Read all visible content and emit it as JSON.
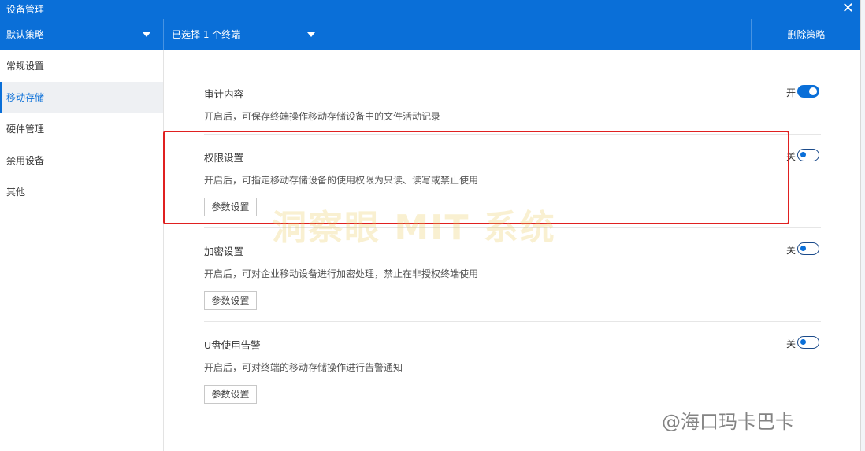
{
  "window": {
    "title": "设备管理",
    "close_glyph": "✕"
  },
  "toolbar": {
    "policy_select": "默认策略",
    "terminal_select": "已选择 1 个终端",
    "delete_label": "删除策略"
  },
  "sidebar": {
    "items": [
      {
        "label": "常规设置",
        "active": false
      },
      {
        "label": "移动存储",
        "active": true
      },
      {
        "label": "硬件管理",
        "active": false
      },
      {
        "label": "禁用设备",
        "active": false
      },
      {
        "label": "其他",
        "active": false
      }
    ]
  },
  "sections": [
    {
      "title": "审计内容",
      "desc": "开启后，可保存终端操作移动存储设备中的文件活动记录",
      "state_label": "开",
      "enabled": true
    },
    {
      "title": "权限设置",
      "desc": "开启后，可指定移动存储设备的使用权限为只读、读写或禁止使用",
      "state_label": "关",
      "enabled": false,
      "button": "参数设置"
    },
    {
      "title": "加密设置",
      "desc": "开启后，可对企业移动设备进行加密处理，禁止在非授权终端使用",
      "state_label": "关",
      "enabled": false,
      "button": "参数设置"
    },
    {
      "title": "U盘使用告警",
      "desc": "开启后，可对终端的移动存储操作进行告警通知",
      "state_label": "关",
      "enabled": false,
      "button": "参数设置"
    }
  ],
  "watermarks": {
    "center": "洞察眼 MIT 系统",
    "corner": "@海口玛卡巴卡"
  },
  "colors": {
    "accent": "#0a6fd8",
    "highlight": "#e02020"
  }
}
